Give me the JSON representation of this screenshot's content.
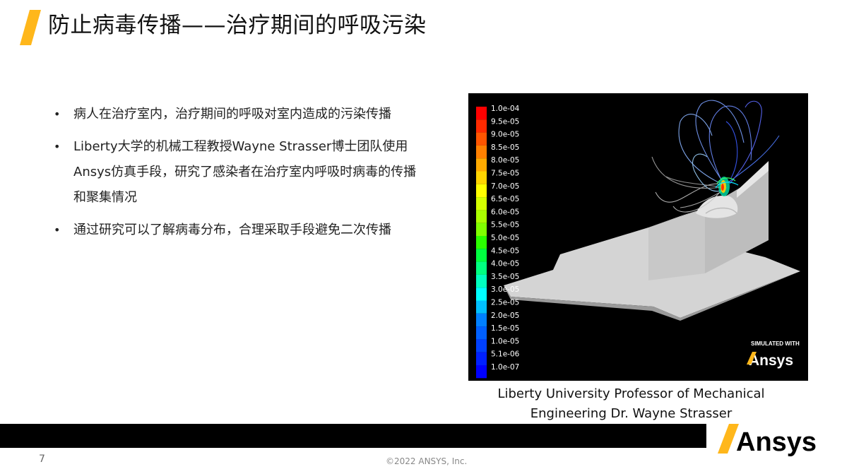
{
  "title": "防止病毒传播——治疗期间的呼吸污染",
  "bullets": [
    "病人在治疗室内，治疗期间的呼吸对室内造成的污染传播",
    "Liberty大学的机械工程教授Wayne Strasser博士团队使用Ansys仿真手段，研究了感染者在治疗室内呼吸时病毒的传播和聚集情况",
    "通过研究可以了解病毒分布，合理采取手段避免二次传播"
  ],
  "simulation": {
    "legend_labels": [
      "1.0e-04",
      "9.5e-05",
      "9.0e-05",
      "8.5e-05",
      "8.0e-05",
      "7.5e-05",
      "7.0e-05",
      "6.5e-05",
      "6.0e-05",
      "5.5e-05",
      "5.0e-05",
      "4.5e-05",
      "4.0e-05",
      "3.5e-05",
      "3.0e-05",
      "2.5e-05",
      "2.0e-05",
      "1.5e-05",
      "1.0e-05",
      "5.1e-06",
      "1.0e-07"
    ],
    "legend_colors": [
      "#ff0000",
      "#ff2a00",
      "#ff5500",
      "#ff8000",
      "#ffaa00",
      "#ffd400",
      "#ffff00",
      "#d4ff00",
      "#aaff00",
      "#80ff00",
      "#2bff00",
      "#00ff40",
      "#00ff80",
      "#00ffbf",
      "#00ffff",
      "#00bfff",
      "#0080ff",
      "#0060ff",
      "#0040ff",
      "#0020ff",
      "#0000ff"
    ],
    "watermark_small": "SIMULATED WITH",
    "watermark_brand": "Ansys"
  },
  "caption": "Liberty University Professor of Mechanical Engineering Dr. Wayne Strasser",
  "footer": {
    "brand": "Ansys",
    "page_number": "7",
    "copyright": "©2022 ANSYS, Inc."
  },
  "colors": {
    "accent": "#ffb71b",
    "bar": "#000000"
  }
}
